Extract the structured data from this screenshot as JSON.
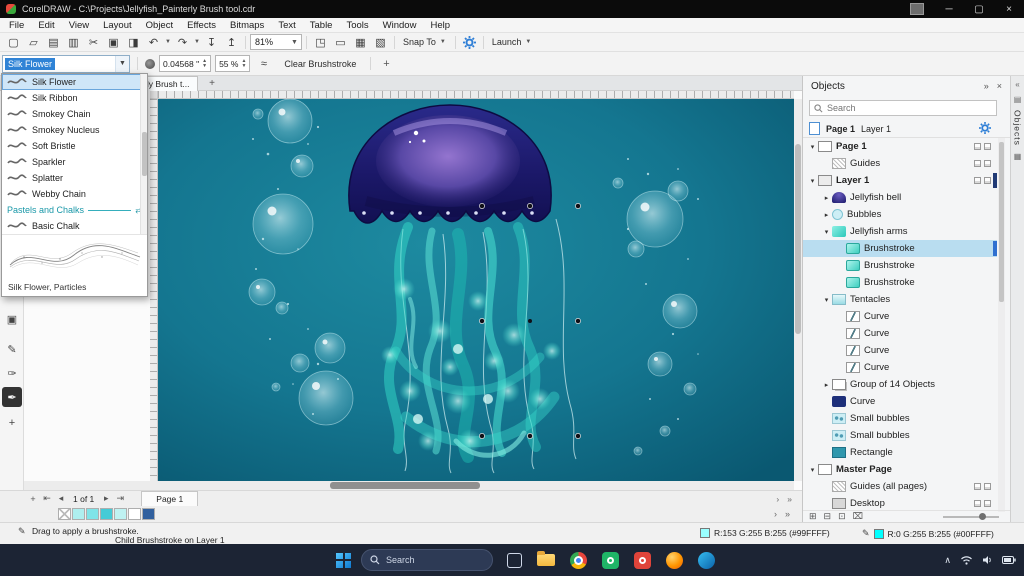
{
  "window": {
    "title": "CorelDRAW - C:\\Projects\\Jellyfish_Painterly Brush tool.cdr"
  },
  "menu_bar": {
    "items": [
      "File",
      "Edit",
      "View",
      "Layout",
      "Object",
      "Effects",
      "Bitmaps",
      "Text",
      "Table",
      "Tools",
      "Window",
      "Help"
    ]
  },
  "standard_toolbar": {
    "icons_left": [
      "new-document",
      "open",
      "save",
      "print",
      "cut",
      "copy",
      "paste",
      "undo",
      "redo",
      "import",
      "export"
    ],
    "icons_view": [
      "full-screen-preview",
      "show-rulers",
      "show-grid",
      "show-guidelines"
    ],
    "zoom_level": "81%",
    "snap_label": "Snap To",
    "launch_label": "Launch"
  },
  "property_bar": {
    "brush_combo_value": "Silk Flower",
    "nib_size": "0.04568 \"",
    "transparency": "55 %",
    "smoothing_icon": "≈",
    "clear_button": "Clear Brushstroke",
    "add_button": "+"
  },
  "document_tabs": {
    "active_tab": "...rly Brush t...",
    "new_tab_button": "+"
  },
  "brush_dropdown": {
    "items": [
      "Silk Flower",
      "Silk Ribbon",
      "Smokey Chain",
      "Smokey Nucleus",
      "Soft Bristle",
      "Sparkler",
      "Splatter",
      "Webby Chain"
    ],
    "selected_item": "Silk Flower",
    "category_header": "Pastels and Chalks",
    "category_items": [
      "Basic Chalk"
    ],
    "preview_caption": "Silk Flower, Particles"
  },
  "objects_docker": {
    "title": "Objects",
    "search_placeholder": "Search",
    "active_page": "Page 1",
    "active_layer": "Layer 1",
    "side_tab": "Objects",
    "tree": [
      {
        "label": "Page 1",
        "level": 0,
        "arrow": "down",
        "icon": "page",
        "right_icons": true
      },
      {
        "label": "Guides",
        "level": 1,
        "arrow": "none",
        "icon": "guides",
        "right_icons": true
      },
      {
        "label": "Layer 1",
        "level": 0,
        "arrow": "down",
        "icon": "layer",
        "right_icons": true,
        "bar": "#203a75"
      },
      {
        "label": "Jellyfish bell",
        "level": 1,
        "arrow": "right",
        "icon": "bell"
      },
      {
        "label": "Bubbles",
        "level": 1,
        "arrow": "right",
        "icon": "bubbles"
      },
      {
        "label": "Jellyfish arms",
        "level": 1,
        "arrow": "down",
        "icon": "arms"
      },
      {
        "label": "Brushstroke",
        "level": 2,
        "arrow": "none",
        "icon": "brush",
        "selected": true,
        "bar": "#2e6fd0"
      },
      {
        "label": "Brushstroke",
        "level": 2,
        "arrow": "none",
        "icon": "brush"
      },
      {
        "label": "Brushstroke",
        "level": 2,
        "arrow": "none",
        "icon": "brush"
      },
      {
        "label": "Tentacles",
        "level": 1,
        "arrow": "down",
        "icon": "tentacle"
      },
      {
        "label": "Curve",
        "level": 2,
        "arrow": "none",
        "icon": "curve"
      },
      {
        "label": "Curve",
        "level": 2,
        "arrow": "none",
        "icon": "curve"
      },
      {
        "label": "Curve",
        "level": 2,
        "arrow": "none",
        "icon": "curve"
      },
      {
        "label": "Curve",
        "level": 2,
        "arrow": "none",
        "icon": "curve"
      },
      {
        "label": "Group of 14 Objects",
        "level": 1,
        "arrow": "right",
        "icon": "group"
      },
      {
        "label": "Curve",
        "level": 1,
        "arrow": "none",
        "icon": "curve-dark"
      },
      {
        "label": "Small bubbles",
        "level": 1,
        "arrow": "none",
        "icon": "small-bubbles"
      },
      {
        "label": "Small bubbles",
        "level": 1,
        "arrow": "none",
        "icon": "small-bubbles"
      },
      {
        "label": "Rectangle",
        "level": 1,
        "arrow": "none",
        "icon": "rectangle"
      },
      {
        "label": "Master Page",
        "level": 0,
        "arrow": "down",
        "icon": "master"
      },
      {
        "label": "Guides (all pages)",
        "level": 1,
        "arrow": "none",
        "icon": "guides",
        "right_icons": true
      },
      {
        "label": "Desktop",
        "level": 1,
        "arrow": "none",
        "icon": "desktop",
        "right_icons": true
      }
    ]
  },
  "page_navigation": {
    "position_label": "1 of 1",
    "page_tab": "Page 1"
  },
  "color_palette": {
    "swatches": [
      "none",
      "#AEEFEF",
      "#7FE4E8",
      "#45CBD6",
      "#BFF2F2",
      "#FFFFFF",
      "#31609E"
    ]
  },
  "status_bar": {
    "hint": "Drag to apply a brushstroke.",
    "selection_info": "Child Brushstroke on Layer 1",
    "fill_color_label": "R:153 G:255 B:255 (#99FFFF)",
    "fill_color_hex": "#99FFFF",
    "outline_color_label": "R:0 G:255 B:255 (#00FFFF)",
    "outline_color_hex": "#00FFFF"
  },
  "taskbar": {
    "search_placeholder": "Search"
  }
}
